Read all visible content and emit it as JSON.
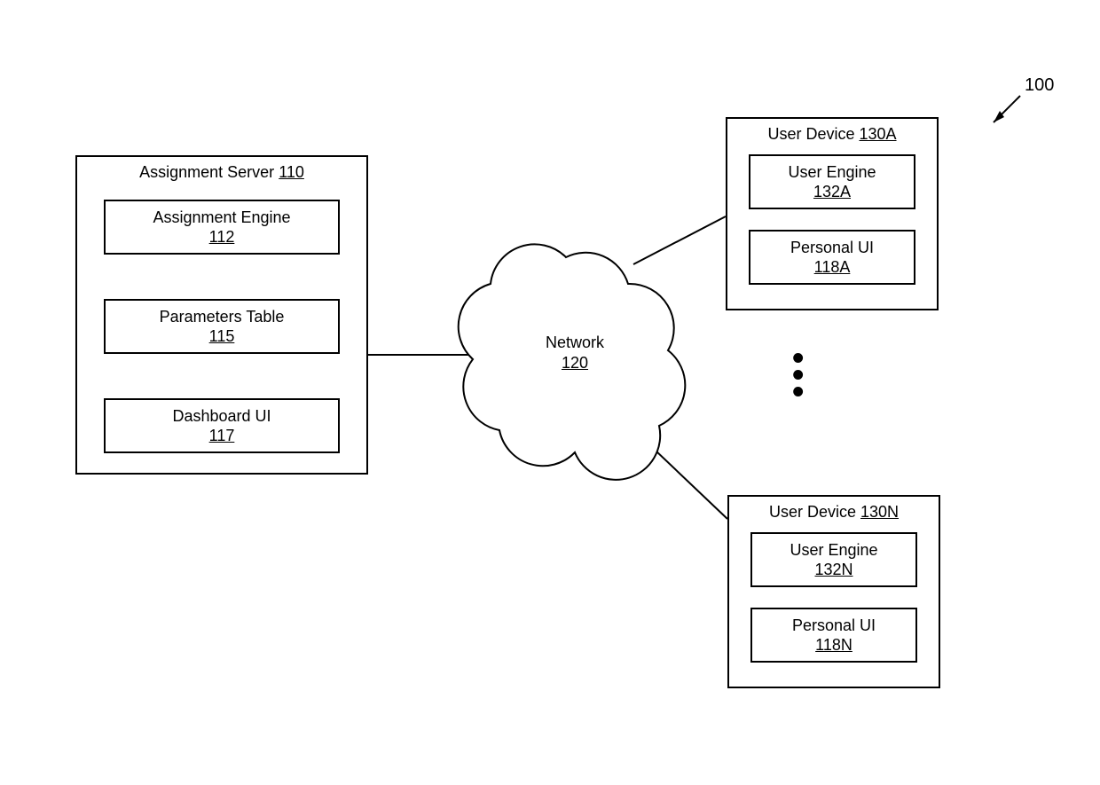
{
  "figure_ref": "100",
  "server": {
    "title_label": "Assignment Server",
    "title_num": "110",
    "engine_label": "Assignment Engine",
    "engine_num": "112",
    "params_label": "Parameters Table",
    "params_num": "115",
    "dash_label": "Dashboard UI",
    "dash_num": "117"
  },
  "network": {
    "label": "Network",
    "num": "120"
  },
  "device_a": {
    "title_label": "User Device",
    "title_num": "130A",
    "engine_label": "User Engine",
    "engine_num": "132A",
    "ui_label": "Personal UI",
    "ui_num": "118A"
  },
  "device_n": {
    "title_label": "User Device",
    "title_num": "130N",
    "engine_label": "User Engine",
    "engine_num": "132N",
    "ui_label": "Personal UI",
    "ui_num": "118N"
  }
}
